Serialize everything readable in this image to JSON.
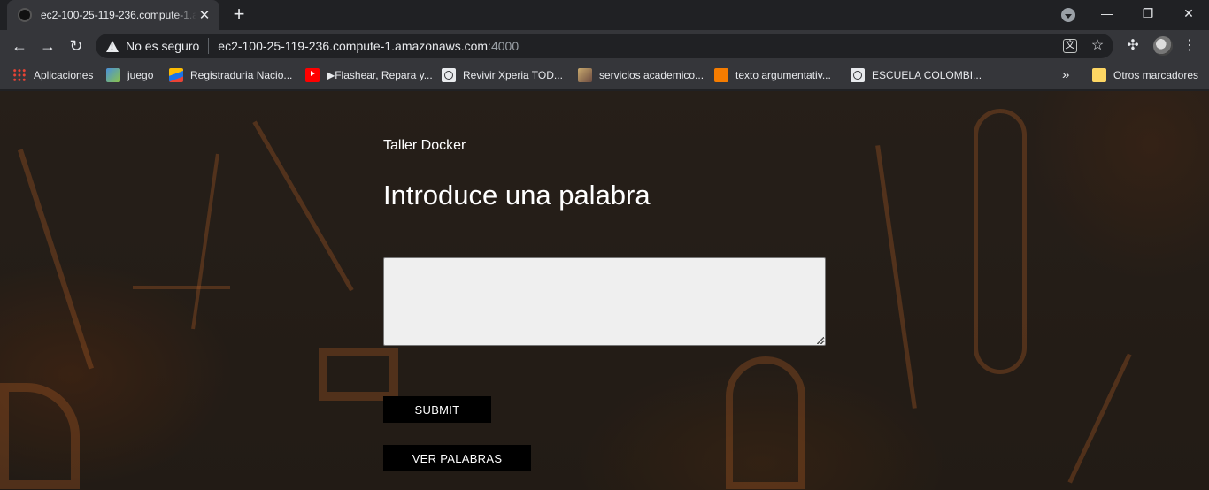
{
  "browser": {
    "tab": {
      "title": "ec2-100-25-119-236.compute-1.amazonaws.com:4000"
    },
    "new_tab": "+",
    "window_controls": {
      "minimize": "—",
      "maximize": "❐",
      "close": "✕"
    },
    "toolbar": {
      "security_text": "No es seguro",
      "url_host": "ec2-100-25-119-236.compute-1.amazonaws.com",
      "url_port": ":4000"
    },
    "bookmarks": [
      {
        "label": "Aplicaciones",
        "icon": "apps-grid-icon"
      },
      {
        "label": "juego",
        "icon": "game-icon"
      },
      {
        "label": "Registraduria Nacio...",
        "icon": "registraduria-icon"
      },
      {
        "label": "▶Flashear, Repara y...",
        "icon": "youtube-icon"
      },
      {
        "label": "Revivir Xperia TOD...",
        "icon": "globe-icon"
      },
      {
        "label": "servicios academico...",
        "icon": "servicios-icon"
      },
      {
        "label": "texto argumentativ...",
        "icon": "blogger-icon"
      },
      {
        "label": "ESCUELA COLOMBI...",
        "icon": "globe-icon"
      }
    ],
    "bookmarks_overflow": "»",
    "other_bookmarks": "Otros marcadores"
  },
  "page": {
    "subtitle": "Taller Docker",
    "heading": "Introduce una palabra",
    "word_input": {
      "value": ""
    },
    "submit_label": "SUBMIT",
    "ver_label": "VER PALABRAS"
  },
  "colors": {
    "browser_frame": "#202124",
    "toolbar": "#35363a",
    "button_bg": "#000000",
    "textarea_bg": "#efefef"
  }
}
